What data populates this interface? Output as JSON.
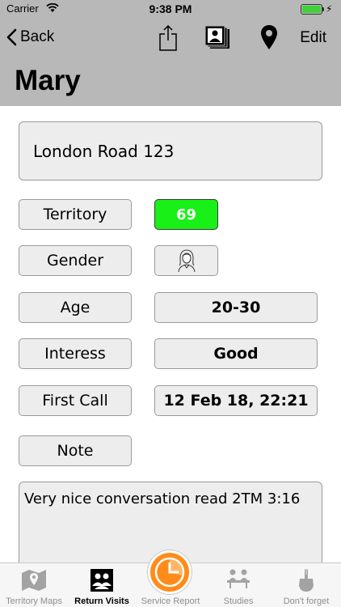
{
  "status_bar": {
    "carrier": "Carrier",
    "time": "9:38 PM"
  },
  "nav": {
    "back_label": "Back",
    "edit_label": "Edit",
    "title": "Mary"
  },
  "address": "London Road 123",
  "fields": {
    "territory": {
      "label": "Territory",
      "value": "69",
      "color": "#18f018"
    },
    "gender": {
      "label": "Gender",
      "icon": "woman-icon"
    },
    "age": {
      "label": "Age",
      "value": "20-30"
    },
    "interest": {
      "label": "Interess",
      "value": "Good"
    },
    "first_call": {
      "label": "First Call",
      "value": "12 Feb 18, 22:21"
    },
    "note": {
      "label": "Note",
      "value": "Very nice conversation read 2TM 3:16"
    }
  },
  "tabs": [
    {
      "label": "Territory Maps",
      "icon": "map-icon"
    },
    {
      "label": "Return Visits",
      "icon": "people-icon",
      "active": true
    },
    {
      "label": "Service Report",
      "icon": "clock-icon"
    },
    {
      "label": "Studies",
      "icon": "study-icon"
    },
    {
      "label": "Don't forget",
      "icon": "finger-icon"
    }
  ],
  "colors": {
    "bar_gray": "#b8b8b8",
    "accent_orange": "#ff8c1a",
    "battery_green": "#43d13b"
  }
}
